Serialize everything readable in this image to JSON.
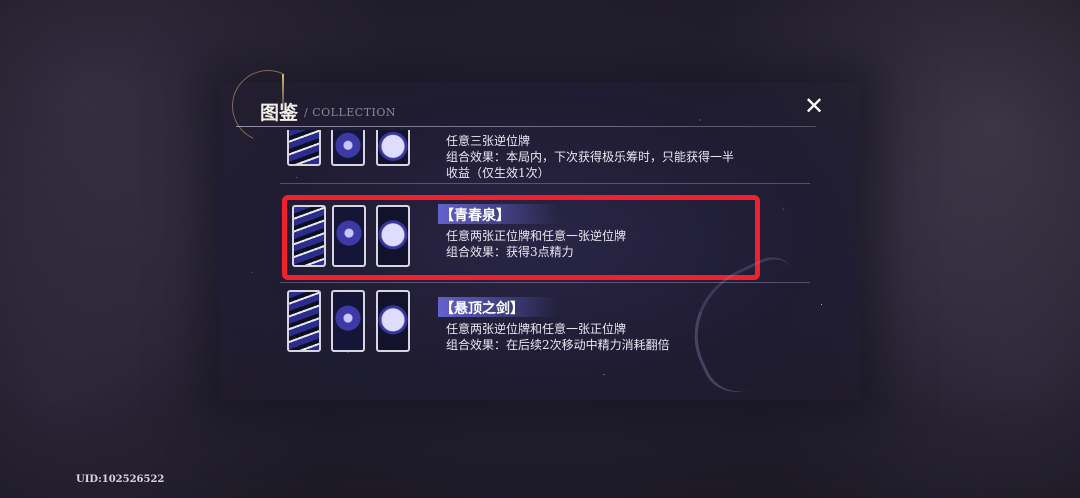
{
  "header": {
    "title": "图鉴",
    "subtitle": "/ COLLECTION",
    "close_label": "✕"
  },
  "combos": [
    {
      "name": "",
      "condition": "任意三张逆位牌",
      "effect_line1": "组合效果：本局内，下次获得极乐筹时，只能获得一半",
      "effect_line2": "收益（仅生效1次）"
    },
    {
      "name": "【青春泉】",
      "condition": "任意两张正位牌和任意一张逆位牌",
      "effect_line1": "组合效果：获得3点精力",
      "highlighted": true
    },
    {
      "name": "【悬顶之剑】",
      "condition": "任意两张逆位牌和任意一张正位牌",
      "effect_line1": "组合效果：在后续2次移动中精力消耗翻倍"
    }
  ],
  "footer": {
    "uid": "UID:102526522"
  },
  "colors": {
    "highlight_border": "#f0212c",
    "label_accent": "#6e6ee6"
  }
}
